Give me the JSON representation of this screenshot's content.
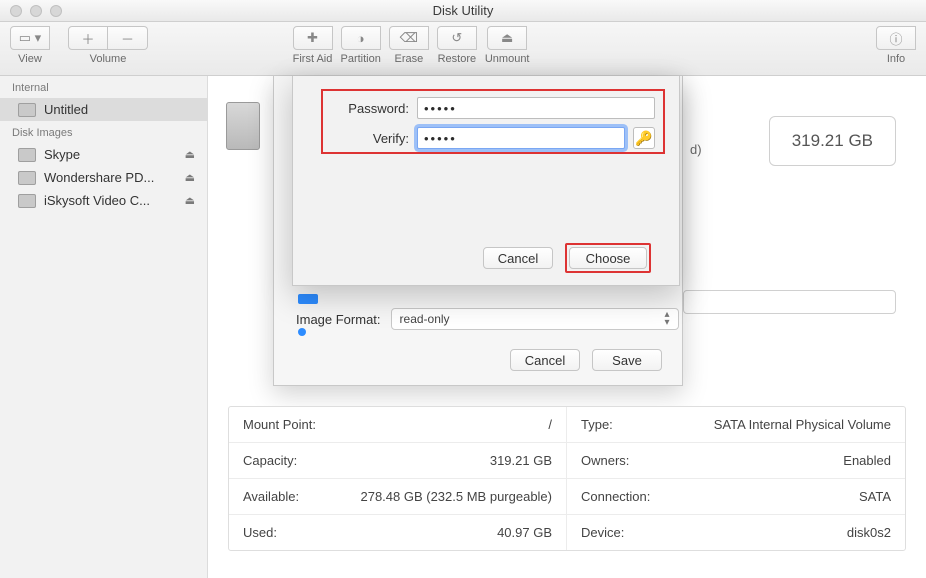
{
  "window": {
    "title": "Disk Utility"
  },
  "toolbar": {
    "view": "View",
    "volume": "Volume",
    "first_aid": "First Aid",
    "partition": "Partition",
    "erase": "Erase",
    "restore": "Restore",
    "unmount": "Unmount",
    "info": "Info"
  },
  "sidebar": {
    "sections": [
      {
        "header": "Internal",
        "items": [
          {
            "label": "Untitled",
            "selected": true,
            "eject": false
          }
        ]
      },
      {
        "header": "Disk Images",
        "items": [
          {
            "label": "Skype",
            "eject": true
          },
          {
            "label": "Wondershare PD...",
            "eject": true
          },
          {
            "label": "iSkysoft Video C...",
            "eject": true
          }
        ]
      }
    ]
  },
  "capacity": {
    "value": "319.21 GB"
  },
  "sheet": {
    "image_format_label": "Image Format:",
    "image_format_value": "read-only",
    "cancel": "Cancel",
    "save": "Save"
  },
  "modal": {
    "password_label": "Password:",
    "verify_label": "Verify:",
    "password_value": "•••••",
    "verify_value": "•••••",
    "cancel": "Cancel",
    "choose": "Choose"
  },
  "details": {
    "left": [
      {
        "label": "Mount Point:",
        "value": "/"
      },
      {
        "label": "Capacity:",
        "value": "319.21 GB"
      },
      {
        "label": "Available:",
        "value": "278.48 GB (232.5 MB purgeable)"
      },
      {
        "label": "Used:",
        "value": "40.97 GB"
      }
    ],
    "right": [
      {
        "label": "Type:",
        "value": "SATA Internal Physical Volume"
      },
      {
        "label": "Owners:",
        "value": "Enabled"
      },
      {
        "label": "Connection:",
        "value": "SATA"
      },
      {
        "label": "Device:",
        "value": "disk0s2"
      }
    ]
  },
  "ghost_d": "d)"
}
